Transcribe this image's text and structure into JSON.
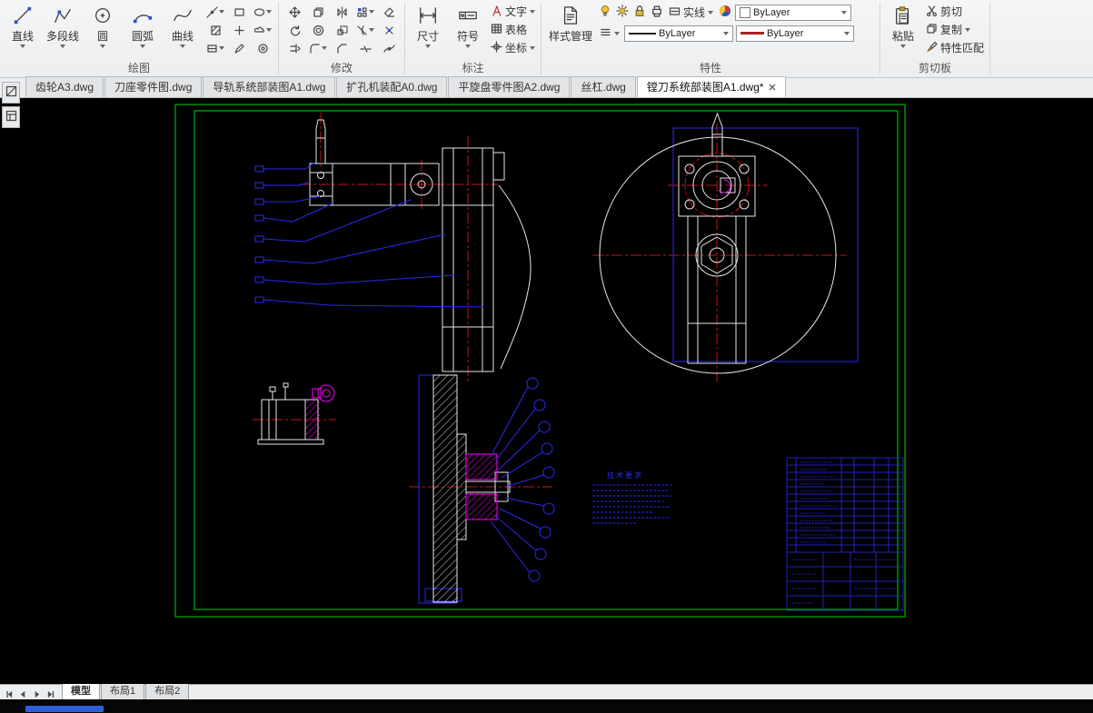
{
  "ribbon": {
    "draw": {
      "label": "绘图",
      "tools": [
        {
          "label": "直线"
        },
        {
          "label": "多段线"
        },
        {
          "label": "圆"
        },
        {
          "label": "圆弧"
        },
        {
          "label": "曲线"
        }
      ]
    },
    "modify": {
      "label": "修改"
    },
    "annotate": {
      "label": "标注",
      "dimension": "尺寸",
      "symbol": "符号",
      "text": "文字",
      "table": "表格",
      "coordinate": "坐标"
    },
    "properties": {
      "label": "特性",
      "style_manager": "样式管理",
      "linetype_quick": "实线",
      "layer_value": "ByLayer",
      "linetype_value": "ByLayer",
      "lineweight_value": "ByLayer"
    },
    "clipboard": {
      "label": "剪切板",
      "paste": "粘贴",
      "cut": "剪切",
      "copy": "复制",
      "match_props": "特性匹配"
    }
  },
  "doc_tabs": [
    {
      "label": "齿轮A3.dwg",
      "active": false
    },
    {
      "label": "刀座零件图.dwg",
      "active": false
    },
    {
      "label": "导轨系统部装图A1.dwg",
      "active": false
    },
    {
      "label": "扩孔机装配A0.dwg",
      "active": false
    },
    {
      "label": "平旋盘零件图A2.dwg",
      "active": false
    },
    {
      "label": "丝杠.dwg",
      "active": false
    },
    {
      "label": "镗刀系统部装图A1.dwg*",
      "active": true
    }
  ],
  "layout_tabs": [
    {
      "label": "模型",
      "active": true
    },
    {
      "label": "布局1",
      "active": false
    },
    {
      "label": "布局2",
      "active": false
    }
  ],
  "drawing": {
    "tech_requirements_title": "技术要求"
  },
  "colors": {
    "frame_green": "#00b400",
    "cad_blue": "#2a2af0",
    "cad_red": "#c41414",
    "cad_magenta": "#ff00ff",
    "cad_white": "#e6e6e6"
  }
}
